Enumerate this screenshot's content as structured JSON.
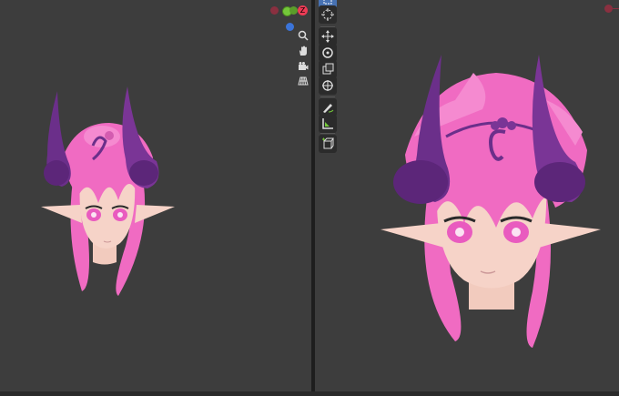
{
  "colors": {
    "viewport_bg": "#3d3d3d",
    "divider": "#1e1e1e",
    "axis_x": "#ee3b55",
    "axis_y": "#74c83a",
    "axis_z": "#3b74d9",
    "horn": "#6b2f8a",
    "hair": "#f06bc2",
    "skin": "#f6d3c8",
    "tool_active": "#4772b3"
  },
  "gizmo": {
    "axes": [
      {
        "name": "x-negative",
        "label": ""
      },
      {
        "name": "y-positive",
        "label": ""
      },
      {
        "name": "z-positive",
        "label": "Z"
      }
    ]
  },
  "viewport_nav_icons": [
    "zoom-icon",
    "hand-pan-icon",
    "camera-view-icon",
    "perspective-grid-icon"
  ],
  "toolbar_icons": [
    "select-box-icon",
    "cursor-icon",
    "move-icon",
    "rotate-icon",
    "scale-icon",
    "transform-icon",
    "annotate-icon",
    "measure-icon",
    "add-cube-icon"
  ]
}
